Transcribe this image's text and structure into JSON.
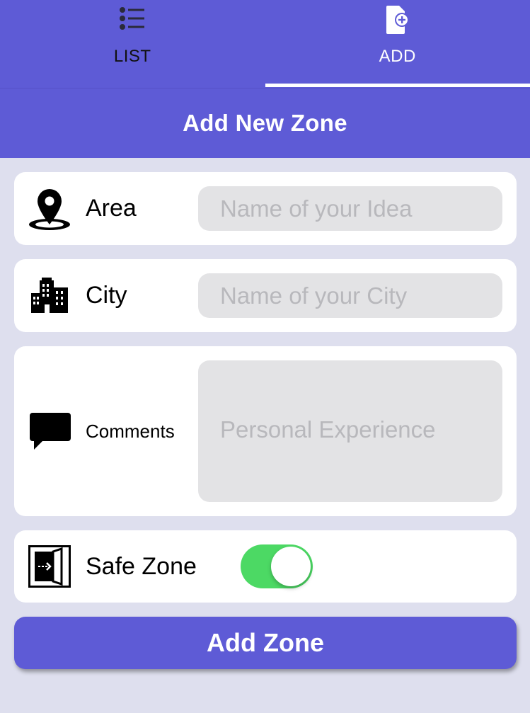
{
  "tabs": [
    {
      "label": "LIST",
      "icon": "list-icon",
      "active": false
    },
    {
      "label": "ADD",
      "icon": "add-document-icon",
      "active": true
    }
  ],
  "header": {
    "title": "Add New Zone"
  },
  "form": {
    "area": {
      "label": "Area",
      "placeholder": "Name of your Idea",
      "icon": "map-pin-icon"
    },
    "city": {
      "label": "City",
      "placeholder": "Name of your City",
      "icon": "city-buildings-icon"
    },
    "comments": {
      "label": "Comments",
      "placeholder": "Personal Experience",
      "icon": "speech-bubble-icon"
    },
    "safe_zone": {
      "label": "Safe Zone",
      "icon": "exit-door-icon",
      "enabled": true
    }
  },
  "submit": {
    "label": "Add Zone"
  },
  "colors": {
    "primary": "#5e5bd6",
    "background": "#dedfee",
    "toggle_on": "#4cd964",
    "field_bg": "#e3e3e5"
  }
}
